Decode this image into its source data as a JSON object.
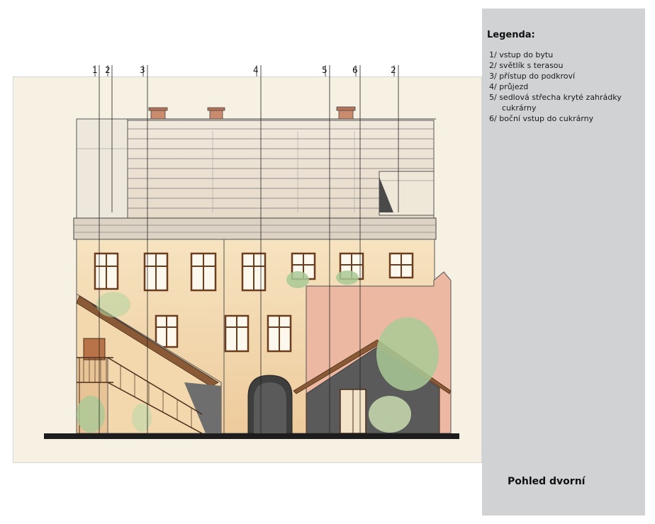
{
  "callouts": [
    "1",
    "2",
    "3",
    "4",
    "5",
    "6",
    "2"
  ],
  "legend": {
    "title": "Legenda:",
    "items": [
      {
        "lines": [
          "1/ vstup do bytu"
        ]
      },
      {
        "lines": [
          "2/ světlík s terasou"
        ]
      },
      {
        "lines": [
          "3/ přístup do podkroví"
        ]
      },
      {
        "lines": [
          "4/ průjezd"
        ]
      },
      {
        "lines": [
          "5/ sedlová střecha kryté zahrádky",
          "cukrárny"
        ]
      },
      {
        "lines": [
          "6/ boční vstup do cukrárny"
        ]
      }
    ]
  },
  "view_title": "Pohled dvorní",
  "colors": {
    "paper": "#f6f1e3",
    "facade": "#f2d9b0",
    "roof": "#ede4d6",
    "annex_wall": "#ecb8a2",
    "panel": "#d1d2d4",
    "window_frame": "#b5652a",
    "greenery": "#a9c995",
    "ground": "#1d1d1d"
  }
}
